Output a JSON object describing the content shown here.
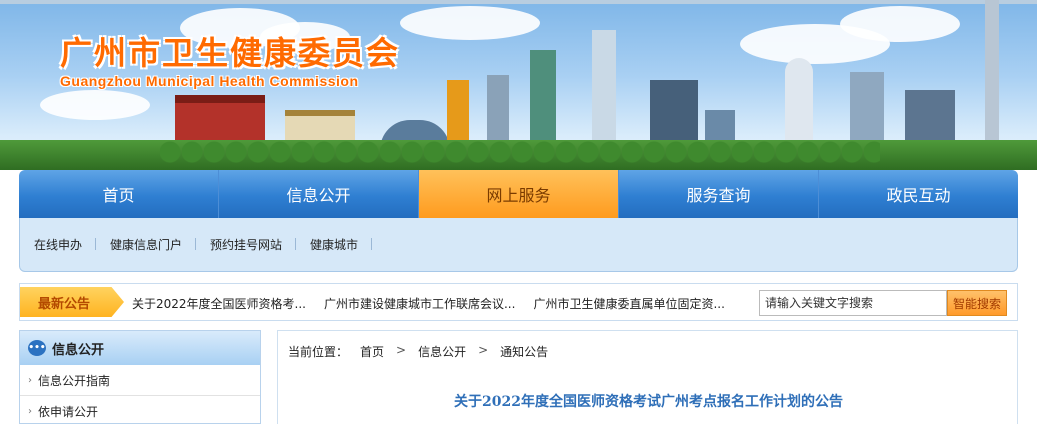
{
  "header": {
    "title": "广州市卫生健康委员会",
    "subtitle": "Guangzhou Municipal Health Commission"
  },
  "nav": {
    "items": [
      "首页",
      "信息公开",
      "网上服务",
      "服务查询",
      "政民互动"
    ],
    "active_index": 2
  },
  "subnav": {
    "items": [
      "在线申办",
      "健康信息门户",
      "预约挂号网站",
      "健康城市"
    ]
  },
  "notice": {
    "label": "最新公告",
    "items": [
      "关于2022年度全国医师资格考...",
      "广州市建设健康城市工作联席会议...",
      "广州市卫生健康委直属单位固定资..."
    ]
  },
  "search": {
    "placeholder": "请输入关键文字搜索",
    "button_label": "智能搜索"
  },
  "sidebar": {
    "heading": "信息公开",
    "items": [
      "信息公开指南",
      "依申请公开"
    ]
  },
  "breadcrumb": {
    "prefix": "当前位置：",
    "items": [
      "首页",
      "信息公开",
      "通知公告"
    ],
    "separator": ">"
  },
  "article": {
    "title": "关于2022年度全国医师资格考试广州考点报名工作计划的公告"
  },
  "colors": {
    "nav_blue": "#2f7fd2",
    "active_orange": "#ff9b1e",
    "title_orange": "#ff6a00",
    "article_title_blue": "#2f6fb8"
  }
}
